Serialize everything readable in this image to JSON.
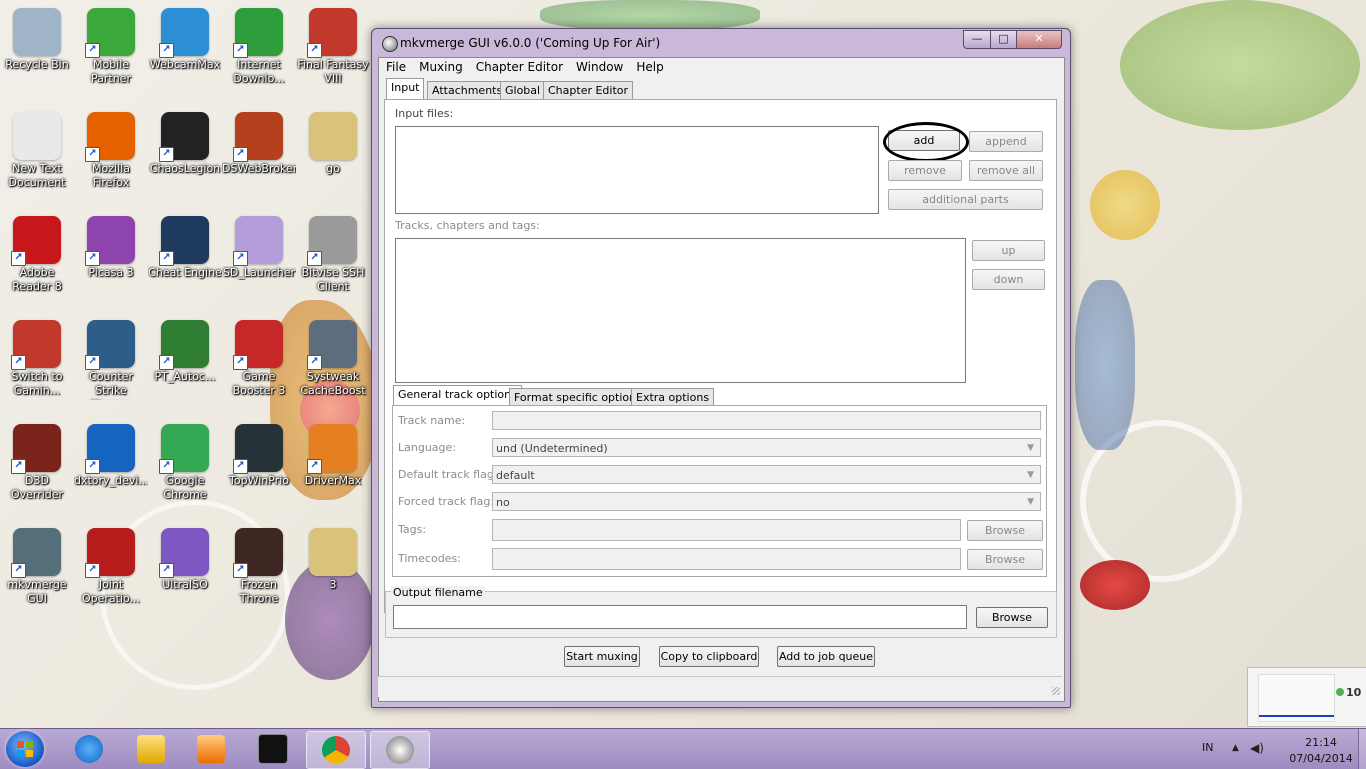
{
  "colors": {
    "taskbar": "#a796c8",
    "window_frame": "#c9b8d9",
    "client_bg": "#f0f0f0",
    "disabled_text": "#8c8c8c"
  },
  "desktop_icons": [
    {
      "label": "Recycle Bin",
      "icon": "recycle-bin-icon",
      "color": "#9fb4c8",
      "shortcut": false
    },
    {
      "label": "Mobile\nPartner",
      "icon": "mobile-partner-icon",
      "color": "#3aa83a",
      "shortcut": true
    },
    {
      "label": "WebcamMax",
      "icon": "webcammax-icon",
      "color": "#2c8fd6",
      "shortcut": true
    },
    {
      "label": "Internet\nDownlo...",
      "icon": "internet-download-manager-icon",
      "color": "#2e9d3c",
      "shortcut": true
    },
    {
      "label": "Final Fantasy\nVIII",
      "icon": "final-fantasy-icon",
      "color": "#c0392b",
      "shortcut": true
    },
    {
      "label": "New Text\nDocument",
      "icon": "text-document-icon",
      "color": "#e9e9e9",
      "shortcut": false
    },
    {
      "label": "Mozilla\nFirefox",
      "icon": "firefox-icon",
      "color": "#e66000",
      "shortcut": true
    },
    {
      "label": "ChaosLegion",
      "icon": "chaoslegion-icon",
      "color": "#222222",
      "shortcut": true
    },
    {
      "label": "DSWebBroker",
      "icon": "dswebbroker-icon",
      "color": "#b5401e",
      "shortcut": true
    },
    {
      "label": "go",
      "icon": "image-file-icon",
      "color": "#d9c27a",
      "shortcut": false
    },
    {
      "label": "Adobe\nReader 8",
      "icon": "adobe-reader-icon",
      "color": "#c8161d",
      "shortcut": true
    },
    {
      "label": "Picasa 3",
      "icon": "picasa-icon",
      "color": "#8e44ad",
      "shortcut": true
    },
    {
      "label": "Cheat Engine",
      "icon": "cheat-engine-icon",
      "color": "#1f3a5f",
      "shortcut": true
    },
    {
      "label": "SD_Launcher",
      "icon": "sd-launcher-icon",
      "color": "#b39ddb",
      "shortcut": true
    },
    {
      "label": "Bitvise SSH\nClient",
      "icon": "bitvise-ssh-icon",
      "color": "#9a9a9a",
      "shortcut": true
    },
    {
      "label": "Switch to\nGamin...",
      "icon": "switch-gaming-icon",
      "color": "#c0392b",
      "shortcut": true
    },
    {
      "label": "Counter\nStrike Xtreme",
      "icon": "counter-strike-icon",
      "color": "#2f5d8a",
      "shortcut": true
    },
    {
      "label": "PT_Autoc...",
      "icon": "pt-autoc-icon",
      "color": "#2e7d32",
      "shortcut": true
    },
    {
      "label": "Game\nBooster 3",
      "icon": "game-booster-icon",
      "color": "#c62828",
      "shortcut": true
    },
    {
      "label": "Systweak\nCacheBoost",
      "icon": "cacheboost-icon",
      "color": "#5d6d7e",
      "shortcut": true
    },
    {
      "label": "D3D\nOverrider",
      "icon": "d3d-overrider-icon",
      "color": "#7b241c",
      "shortcut": true
    },
    {
      "label": "dxtory_devi...",
      "icon": "dxtory-icon",
      "color": "#1565c0",
      "shortcut": true
    },
    {
      "label": "Google\nChrome",
      "icon": "chrome-icon",
      "color": "#34a853",
      "shortcut": true
    },
    {
      "label": "TopWinPrio",
      "icon": "topwinprio-icon",
      "color": "#263238",
      "shortcut": true
    },
    {
      "label": "DriverMax",
      "icon": "drivermax-icon",
      "color": "#e67e22",
      "shortcut": true
    },
    {
      "label": "mkvmerge\nGUI",
      "icon": "mkvmerge-icon",
      "color": "#546e7a",
      "shortcut": true
    },
    {
      "label": "Joint\nOperatio...",
      "icon": "joint-operations-icon",
      "color": "#b71c1c",
      "shortcut": true
    },
    {
      "label": "UltraISO",
      "icon": "ultraiso-icon",
      "color": "#7e57c2",
      "shortcut": true
    },
    {
      "label": "Frozen\nThrone",
      "icon": "frozen-throne-icon",
      "color": "#3e2723",
      "shortcut": true
    },
    {
      "label": "3",
      "icon": "image-file-icon",
      "color": "#d9c27a",
      "shortcut": false
    }
  ],
  "window": {
    "title": "mkvmerge GUI v6.0.0 ('Coming Up For Air')",
    "minimize": "—",
    "maximize": "□",
    "close": "✕"
  },
  "menu": [
    "File",
    "Muxing",
    "Chapter Editor",
    "Window",
    "Help"
  ],
  "tabs": [
    "Input",
    "Attachments",
    "Global",
    "Chapter Editor"
  ],
  "input": {
    "input_files_label": "Input files:",
    "add": "add",
    "append": "append",
    "remove": "remove",
    "remove_all": "remove all",
    "additional_parts": "additional parts",
    "tracks_label": "Tracks, chapters and tags:",
    "up": "up",
    "down": "down"
  },
  "subtabs": [
    "General track options",
    "Format specific options",
    "Extra options"
  ],
  "track_options": {
    "track_name_label": "Track name:",
    "track_name_value": "",
    "language_label": "Language:",
    "language_value": "und (Undetermined)",
    "default_flag_label": "Default track flag:",
    "default_flag_value": "default",
    "forced_flag_label": "Forced track flag:",
    "forced_flag_value": "no",
    "tags_label": "Tags:",
    "tags_value": "",
    "timecodes_label": "Timecodes:",
    "timecodes_value": "",
    "browse": "Browse"
  },
  "output": {
    "label": "Output filename",
    "value": "",
    "browse": "Browse"
  },
  "actions": {
    "start_muxing": "Start muxing",
    "copy_to_clipboard": "Copy to clipboard",
    "add_to_job_queue": "Add to job queue"
  },
  "taskbar": {
    "items": [
      "internet-explorer-icon",
      "file-explorer-icon",
      "media-player-icon",
      "command-prompt-icon",
      "chrome-icon",
      "mkvmerge-icon"
    ],
    "language": "IN",
    "time": "21:14",
    "date": "07/04/2014"
  },
  "gadget": {
    "value": "10"
  }
}
